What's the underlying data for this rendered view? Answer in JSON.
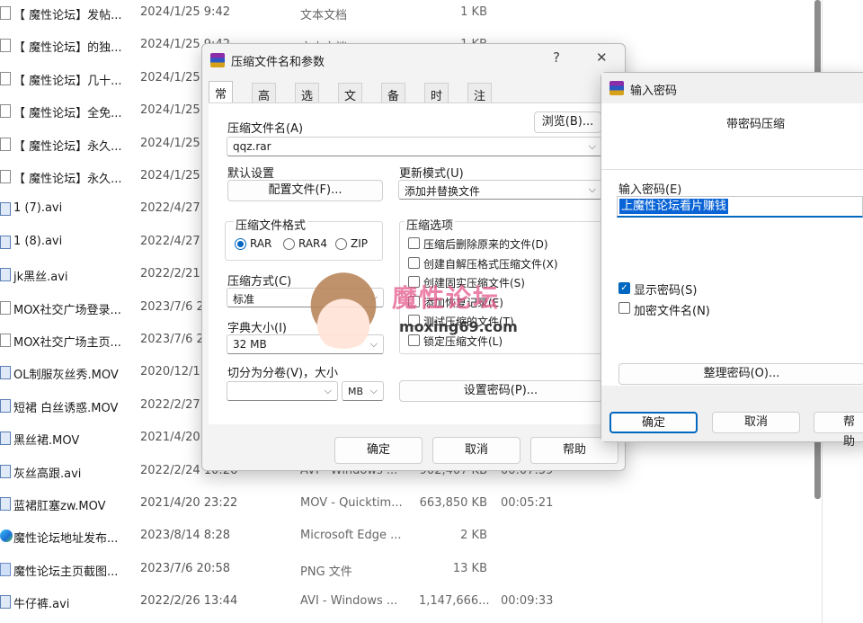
{
  "explorer": {
    "rows": [
      {
        "icon": "text-file-icon",
        "name": "【 魔性论坛】发帖...",
        "date": "2024/1/25 9:42",
        "type": "文本文档",
        "size": "1 KB",
        "duration": ""
      },
      {
        "icon": "text-file-icon",
        "name": "【 魔性论坛】的独...",
        "date": "2024/1/25 9:42",
        "type": "文本文档",
        "size": "1 KB",
        "duration": ""
      },
      {
        "icon": "text-file-icon",
        "name": "【 魔性论坛】几十...",
        "date": "2024/1/25",
        "type": "",
        "size": "",
        "duration": ""
      },
      {
        "icon": "text-file-icon",
        "name": "【 魔性论坛】全免...",
        "date": "2024/1/25",
        "type": "",
        "size": "",
        "duration": ""
      },
      {
        "icon": "text-file-icon",
        "name": "【 魔性论坛】永久...",
        "date": "2024/1/25",
        "type": "",
        "size": "",
        "duration": ""
      },
      {
        "icon": "text-file-icon",
        "name": "【 魔性论坛】永久...",
        "date": "2024/1/25",
        "type": "",
        "size": "",
        "duration": ""
      },
      {
        "icon": "video-file-icon",
        "name": "1 (7).avi",
        "date": "2022/4/27",
        "type": "",
        "size": "",
        "duration": ""
      },
      {
        "icon": "video-file-icon",
        "name": "1 (8).avi",
        "date": "2022/4/27",
        "type": "",
        "size": "",
        "duration": ""
      },
      {
        "icon": "video-file-icon",
        "name": "jk黑丝.avi",
        "date": "2022/2/21",
        "type": "",
        "size": "",
        "duration": ""
      },
      {
        "icon": "text-file-icon",
        "name": "MOX社交广场登录...",
        "date": "2023/7/6 2",
        "type": "",
        "size": "",
        "duration": ""
      },
      {
        "icon": "text-file-icon",
        "name": "MOX社交广场主页...",
        "date": "2023/7/6 2",
        "type": "",
        "size": "",
        "duration": ""
      },
      {
        "icon": "video-file-icon",
        "name": "OL制服灰丝秀.MOV",
        "date": "2020/12/1",
        "type": "",
        "size": "",
        "duration": ""
      },
      {
        "icon": "video-file-icon",
        "name": "短裙 白丝诱惑.MOV",
        "date": "2022/2/27",
        "type": "",
        "size": "",
        "duration": ""
      },
      {
        "icon": "video-file-icon",
        "name": "黑丝裙.MOV",
        "date": "2021/4/20",
        "type": "",
        "size": "",
        "duration": ""
      },
      {
        "icon": "video-file-icon",
        "name": "灰丝高跟.avi",
        "date": "2022/2/24 10:26",
        "type": "AVI - Windows ...",
        "size": "902,407 KB",
        "duration": "00:07:59"
      },
      {
        "icon": "video-file-icon",
        "name": "蓝裙肛塞zw.MOV",
        "date": "2021/4/20 23:22",
        "type": "MOV - Quicktim...",
        "size": "663,850 KB",
        "duration": "00:05:21"
      },
      {
        "icon": "edge-icon",
        "name": "魔性论坛地址发布...",
        "date": "2023/8/14 8:28",
        "type": "Microsoft Edge ...",
        "size": "2 KB",
        "duration": ""
      },
      {
        "icon": "image-file-icon",
        "name": "魔性论坛主页截图...",
        "date": "2023/7/6 20:58",
        "type": "PNG 文件",
        "size": "13 KB",
        "duration": ""
      },
      {
        "icon": "video-file-icon",
        "name": "牛仔裤.avi",
        "date": "2022/2/26 13:44",
        "type": "AVI - Windows ...",
        "size": "1,147,666...",
        "duration": "00:09:33"
      }
    ]
  },
  "archive_dialog": {
    "title": "压缩文件名和参数",
    "help_btn": "?",
    "close_btn": "✕",
    "tabs": [
      "常规",
      "高级",
      "选项",
      "文件",
      "备份",
      "时间",
      "注释"
    ],
    "archive_name_label": "压缩文件名(A)",
    "browse_btn": "浏览(B)...",
    "archive_name_value": "qqz.rar",
    "default_settings_label": "默认设置",
    "profiles_btn": "配置文件(F)...",
    "update_mode_label": "更新模式(U)",
    "update_mode_value": "添加并替换文件",
    "format_label": "压缩文件格式",
    "formats": [
      "RAR",
      "RAR4",
      "ZIP"
    ],
    "options_label": "压缩选项",
    "options": [
      "压缩后删除原来的文件(D)",
      "创建自解压格式压缩文件(X)",
      "创建固实压缩文件(S)",
      "添加恢复记录(E)",
      "测试压缩的文件(T)",
      "锁定压缩文件(L)"
    ],
    "method_label": "压缩方式(C)",
    "method_value": "标准",
    "dict_label": "字典大小(I)",
    "dict_value": "32 MB",
    "split_label": "切分为分卷(V)，大小",
    "split_unit": "MB",
    "set_password_btn": "设置密码(P)...",
    "ok_btn": "确定",
    "cancel_btn": "取消",
    "help_btn_footer": "帮助"
  },
  "password_dialog": {
    "title": "输入密码",
    "heading": "带密码压缩",
    "password_label": "输入密码(E)",
    "password_value": "上魔性论坛看片赚钱",
    "show_password": "显示密码(S)",
    "encrypt_names": "加密文件名(N)",
    "organize_btn": "整理密码(O)...",
    "ok_btn": "确定",
    "cancel_btn": "取消",
    "help_btn": "帮助"
  },
  "watermark": {
    "title": "魔性论坛",
    "url": "moxing69.com"
  }
}
